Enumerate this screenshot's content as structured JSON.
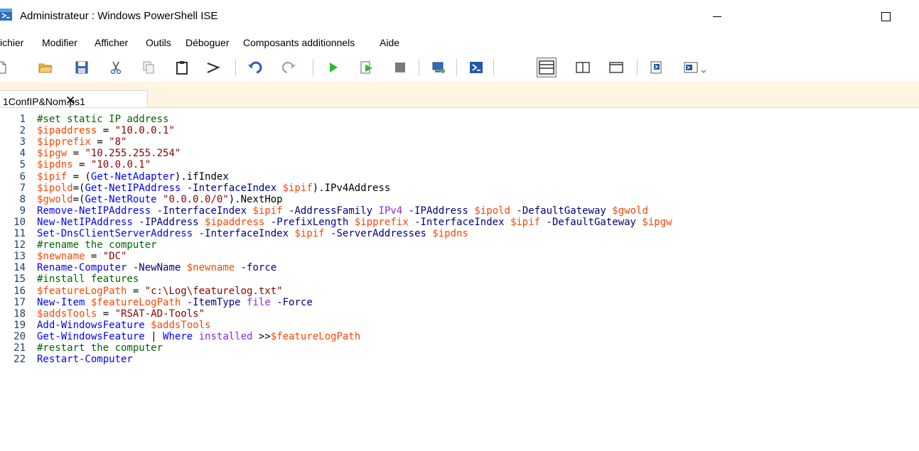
{
  "window": {
    "title": "Administrateur : Windows PowerShell ISE",
    "app_icon": "powershell-ise-icon"
  },
  "menu": {
    "items": [
      "ichier",
      "Modifier",
      "Afficher",
      "Outils",
      "Déboguer",
      "Composants additionnels",
      "Aide"
    ]
  },
  "toolbar": {
    "buttons": [
      {
        "name": "new-file-icon"
      },
      {
        "name": "open-folder-icon"
      },
      {
        "name": "save-icon"
      },
      {
        "name": "cut-icon"
      },
      {
        "name": "copy-icon"
      },
      {
        "name": "paste-icon"
      },
      {
        "name": "clear-console-icon"
      },
      {
        "name": "undo-icon"
      },
      {
        "name": "redo-icon"
      },
      {
        "name": "run-script-icon"
      },
      {
        "name": "run-selection-icon"
      },
      {
        "name": "stop-icon"
      },
      {
        "name": "remote-powershell-icon"
      },
      {
        "name": "powershell-console-icon"
      },
      {
        "name": "layout-script-top-icon"
      },
      {
        "name": "layout-script-right-icon"
      },
      {
        "name": "layout-script-maximized-icon"
      },
      {
        "name": "show-script-pane-icon"
      },
      {
        "name": "show-command-addon-icon"
      },
      {
        "name": "toolbar-overflow-icon"
      }
    ]
  },
  "tab": {
    "label": "1ConfIP&Nom.ps1",
    "close": "✕"
  },
  "colors": {
    "comment": "#006400",
    "variable": "#ff4500",
    "string": "#8b0000",
    "command": "#0000ff",
    "parameter": "#000080",
    "tab_strip_bg": "#fef4e0",
    "line_number": "#1f3f6f"
  },
  "editor": {
    "lines": [
      {
        "n": "1",
        "tokens": [
          [
            "comment",
            "#set static IP address"
          ]
        ]
      },
      {
        "n": "2",
        "tokens": [
          [
            "variable",
            "$ipaddress"
          ],
          [
            "plain",
            " = "
          ],
          [
            "string",
            "\"10.0.0.1\""
          ]
        ]
      },
      {
        "n": "3",
        "tokens": [
          [
            "variable",
            "$ipprefix"
          ],
          [
            "plain",
            " = "
          ],
          [
            "string",
            "\"8\""
          ]
        ]
      },
      {
        "n": "4",
        "tokens": [
          [
            "variable",
            "$ipgw"
          ],
          [
            "plain",
            " = "
          ],
          [
            "string",
            "\"10.255.255.254\""
          ]
        ]
      },
      {
        "n": "5",
        "tokens": [
          [
            "variable",
            "$ipdns"
          ],
          [
            "plain",
            " = "
          ],
          [
            "string",
            "\"10.0.0.1\""
          ]
        ]
      },
      {
        "n": "6",
        "tokens": [
          [
            "variable",
            "$ipif"
          ],
          [
            "plain",
            " = ("
          ],
          [
            "command",
            "Get-NetAdapter"
          ],
          [
            "plain",
            ").ifIndex"
          ]
        ]
      },
      {
        "n": "7",
        "tokens": [
          [
            "variable",
            "$ipold"
          ],
          [
            "plain",
            "=("
          ],
          [
            "command",
            "Get-NetIPAddress"
          ],
          [
            "plain",
            " "
          ],
          [
            "parameter",
            "-InterfaceIndex"
          ],
          [
            "plain",
            " "
          ],
          [
            "variable",
            "$ipif"
          ],
          [
            "plain",
            ").IPv4Address"
          ]
        ]
      },
      {
        "n": "8",
        "tokens": [
          [
            "variable",
            "$gwold"
          ],
          [
            "plain",
            "=("
          ],
          [
            "command",
            "Get-NetRoute"
          ],
          [
            "plain",
            " "
          ],
          [
            "string",
            "\"0.0.0.0/0\""
          ],
          [
            "plain",
            ").NextHop"
          ]
        ]
      },
      {
        "n": "9",
        "tokens": [
          [
            "command",
            "Remove-NetIPAddress"
          ],
          [
            "plain",
            " "
          ],
          [
            "parameter",
            "-InterfaceIndex"
          ],
          [
            "plain",
            " "
          ],
          [
            "variable",
            "$ipif"
          ],
          [
            "plain",
            " "
          ],
          [
            "parameter",
            "-AddressFamily"
          ],
          [
            "plain",
            " "
          ],
          [
            "argument",
            "IPv4"
          ],
          [
            "plain",
            " "
          ],
          [
            "parameter",
            "-IPAddress"
          ],
          [
            "plain",
            " "
          ],
          [
            "variable",
            "$ipold"
          ],
          [
            "plain",
            " "
          ],
          [
            "parameter",
            "-DefaultGateway"
          ],
          [
            "plain",
            " "
          ],
          [
            "variable",
            "$gwold"
          ]
        ]
      },
      {
        "n": "10",
        "tokens": [
          [
            "command",
            "New-NetIPAddress"
          ],
          [
            "plain",
            " "
          ],
          [
            "parameter",
            "-IPAddress"
          ],
          [
            "plain",
            " "
          ],
          [
            "variable",
            "$ipaddress"
          ],
          [
            "plain",
            " "
          ],
          [
            "parameter",
            "-PrefixLength"
          ],
          [
            "plain",
            " "
          ],
          [
            "variable",
            "$ipprefix"
          ],
          [
            "plain",
            " "
          ],
          [
            "parameter",
            "-InterfaceIndex"
          ],
          [
            "plain",
            " "
          ],
          [
            "variable",
            "$ipif"
          ],
          [
            "plain",
            " "
          ],
          [
            "parameter",
            "-DefaultGateway"
          ],
          [
            "plain",
            " "
          ],
          [
            "variable",
            "$ipgw"
          ]
        ]
      },
      {
        "n": "11",
        "tokens": [
          [
            "command",
            "Set-DnsClientServerAddress"
          ],
          [
            "plain",
            " "
          ],
          [
            "parameter",
            "-InterfaceIndex"
          ],
          [
            "plain",
            " "
          ],
          [
            "variable",
            "$ipif"
          ],
          [
            "plain",
            " "
          ],
          [
            "parameter",
            "-ServerAddresses"
          ],
          [
            "plain",
            " "
          ],
          [
            "variable",
            "$ipdns"
          ]
        ]
      },
      {
        "n": "12",
        "tokens": [
          [
            "comment",
            "#rename the computer"
          ]
        ]
      },
      {
        "n": "13",
        "tokens": [
          [
            "variable",
            "$newname"
          ],
          [
            "plain",
            " = "
          ],
          [
            "string",
            "\"DC\""
          ]
        ]
      },
      {
        "n": "14",
        "tokens": [
          [
            "command",
            "Rename-Computer"
          ],
          [
            "plain",
            " "
          ],
          [
            "parameter",
            "-NewName"
          ],
          [
            "plain",
            " "
          ],
          [
            "variable",
            "$newname"
          ],
          [
            "plain",
            " "
          ],
          [
            "parameter",
            "-force"
          ]
        ]
      },
      {
        "n": "15",
        "tokens": [
          [
            "comment",
            "#install features"
          ]
        ]
      },
      {
        "n": "16",
        "tokens": [
          [
            "variable",
            "$featureLogPath"
          ],
          [
            "plain",
            " = "
          ],
          [
            "string",
            "\"c:\\Log\\featurelog.txt\""
          ]
        ]
      },
      {
        "n": "17",
        "tokens": [
          [
            "command",
            "New-Item"
          ],
          [
            "plain",
            " "
          ],
          [
            "variable",
            "$featureLogPath"
          ],
          [
            "plain",
            " "
          ],
          [
            "parameter",
            "-ItemType"
          ],
          [
            "plain",
            " "
          ],
          [
            "argument",
            "file"
          ],
          [
            "plain",
            " "
          ],
          [
            "parameter",
            "-Force"
          ]
        ]
      },
      {
        "n": "18",
        "tokens": [
          [
            "variable",
            "$addsTools"
          ],
          [
            "plain",
            " = "
          ],
          [
            "string",
            "\"RSAT-AD-Tools\""
          ]
        ]
      },
      {
        "n": "19",
        "tokens": [
          [
            "command",
            "Add-WindowsFeature"
          ],
          [
            "plain",
            " "
          ],
          [
            "variable",
            "$addsTools"
          ]
        ]
      },
      {
        "n": "20",
        "tokens": [
          [
            "command",
            "Get-WindowsFeature"
          ],
          [
            "plain",
            " | "
          ],
          [
            "command",
            "Where"
          ],
          [
            "plain",
            " "
          ],
          [
            "argument",
            "installed"
          ],
          [
            "plain",
            " >>"
          ],
          [
            "variable",
            "$featureLogPath"
          ]
        ]
      },
      {
        "n": "21",
        "tokens": [
          [
            "comment",
            "#restart the computer"
          ]
        ]
      },
      {
        "n": "22",
        "tokens": [
          [
            "command",
            "Restart-Computer"
          ]
        ]
      }
    ]
  }
}
